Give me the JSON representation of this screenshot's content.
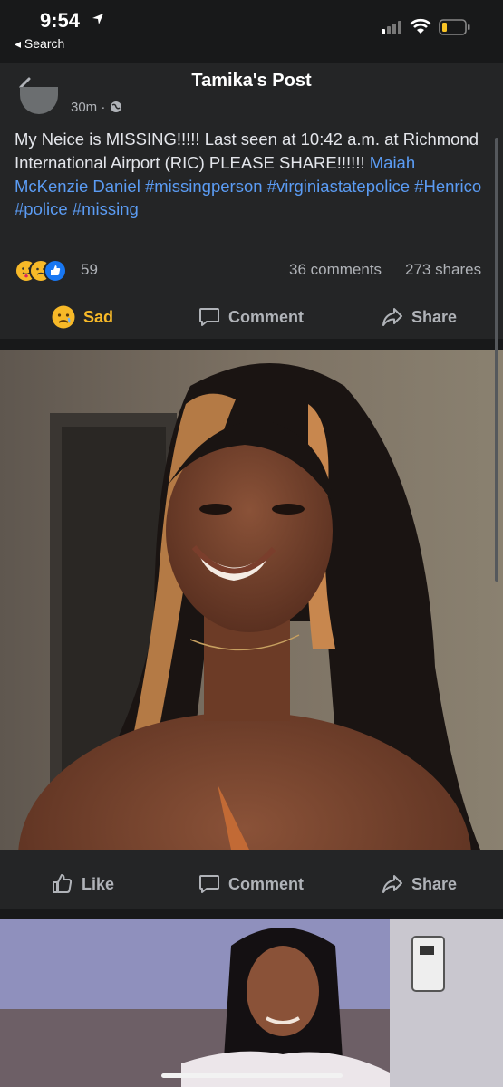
{
  "status_bar": {
    "time": "9:54",
    "back_app_label": "◂ Search"
  },
  "header": {
    "title": "Tamika's Post"
  },
  "post": {
    "timestamp": "30m ·",
    "text_plain": "My Neice is MISSING!!!!!  Last seen at 10:42 a.m. at Richmond International Airport (RIC) PLEASE SHARE!!!!!!",
    "tag_name": "Maiah McKenzie Daniel",
    "hashtags": [
      "#missingperson",
      "#virginiastatepolice",
      "#Henrico",
      "#police",
      "#missing"
    ],
    "reaction_count": "59",
    "comments": "36 comments",
    "shares": "273 shares",
    "actions": {
      "sad": "Sad",
      "comment": "Comment",
      "share": "Share"
    }
  },
  "photo_actions": {
    "like": "Like",
    "comment": "Comment",
    "share": "Share"
  },
  "colors": {
    "link": "#5b9cf4",
    "sad_accent": "#f7b928",
    "card_bg": "#242526",
    "page_bg": "#18191a"
  }
}
